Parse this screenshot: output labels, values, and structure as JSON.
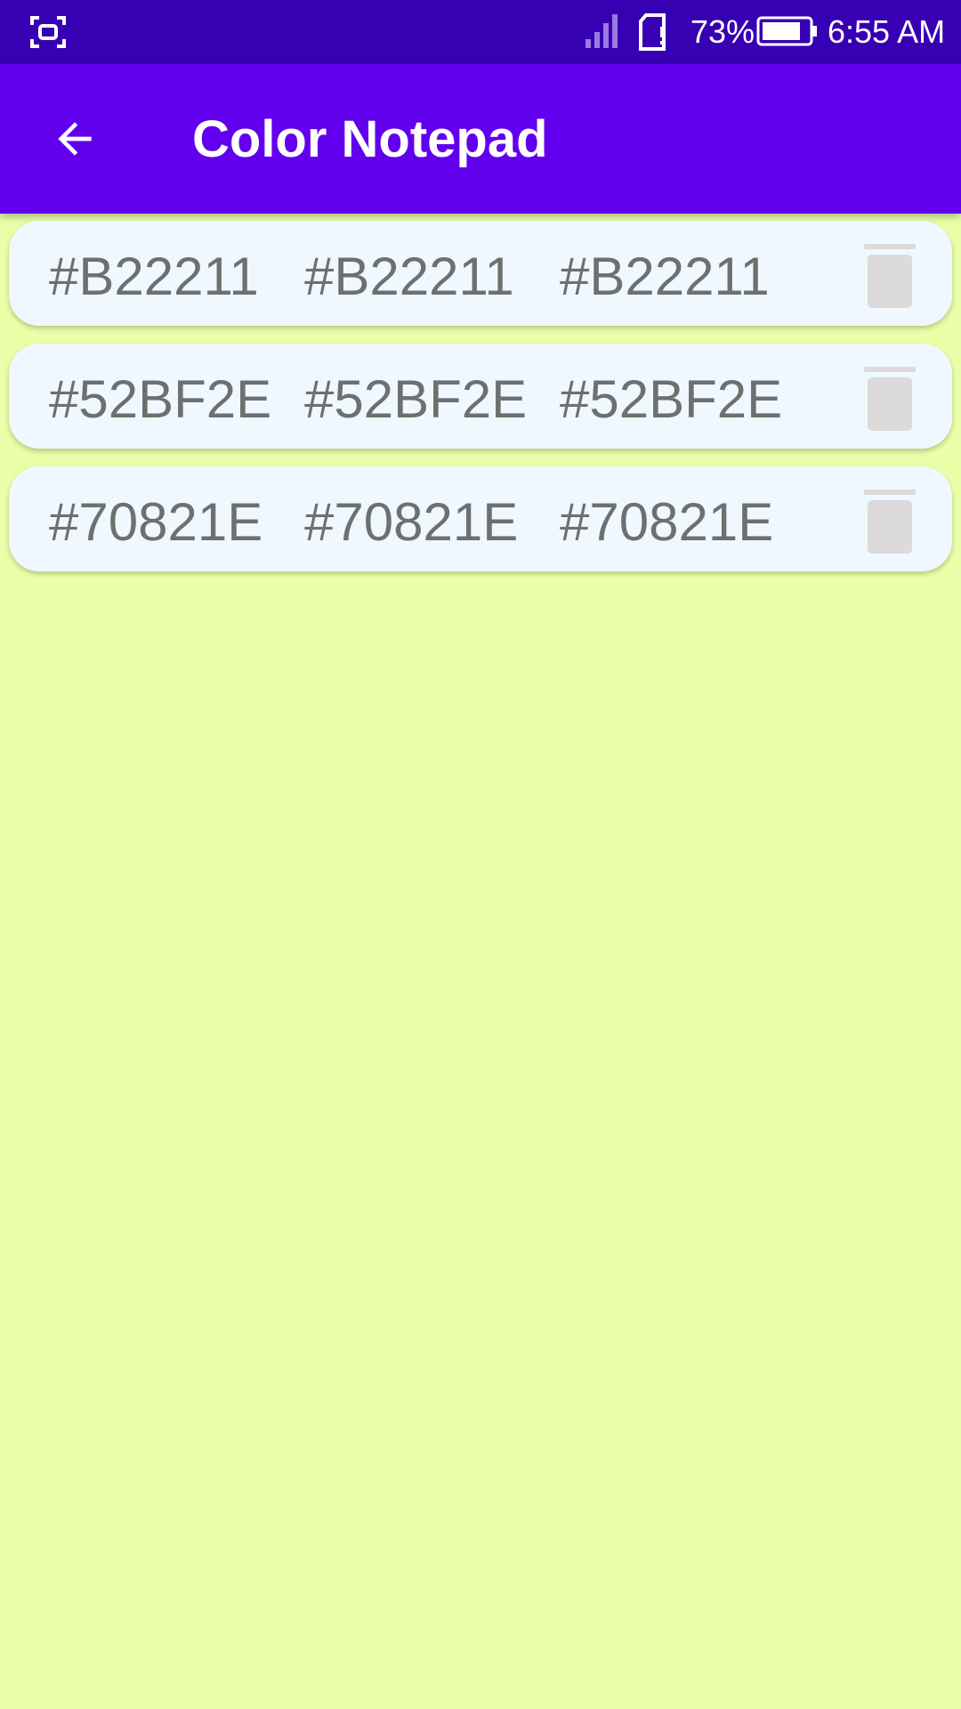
{
  "status_bar": {
    "battery_percent": "73%",
    "time": "6:55 AM",
    "icons": [
      "screenshot-icon",
      "signal-icon",
      "sim-card-icon",
      "battery-icon"
    ]
  },
  "app_bar": {
    "title": "Color Notepad",
    "back_icon": "arrow-back-icon"
  },
  "colors": {
    "status_bar_bg": "#3700B3",
    "app_bar_bg": "#6200EE",
    "page_bg": "#EBFFA8",
    "card_bg": "#F0F8FF",
    "code_text": "#6E7070",
    "delete_icon": "#DCDADA"
  },
  "notes": [
    {
      "codes": [
        "#B22211",
        "#B22211",
        "#B22211"
      ],
      "delete_icon": "trash-icon"
    },
    {
      "codes": [
        "#52BF2E",
        "#52BF2E",
        "#52BF2E"
      ],
      "delete_icon": "trash-icon"
    },
    {
      "codes": [
        "#70821E",
        "#70821E",
        "#70821E"
      ],
      "delete_icon": "trash-icon"
    }
  ]
}
